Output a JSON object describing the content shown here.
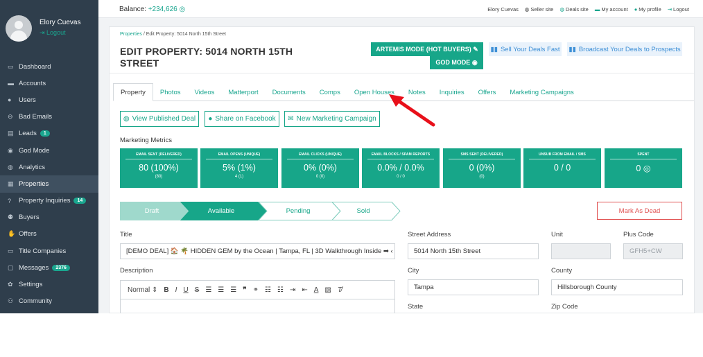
{
  "user": {
    "name": "Elory Cuevas",
    "logout": "Logout"
  },
  "sidebar": {
    "items": [
      {
        "label": "Dashboard",
        "icon": "▭"
      },
      {
        "label": "Accounts",
        "icon": "▬"
      },
      {
        "label": "Users",
        "icon": "●"
      },
      {
        "label": "Bad Emails",
        "icon": "⊖"
      },
      {
        "label": "Leads",
        "icon": "▤",
        "badge": "1"
      },
      {
        "label": "God Mode",
        "icon": "◉"
      },
      {
        "label": "Analytics",
        "icon": "◍"
      },
      {
        "label": "Properties",
        "icon": "▦"
      },
      {
        "label": "Property Inquiries",
        "icon": "?",
        "badge": "14"
      },
      {
        "label": "Buyers",
        "icon": "⚉"
      },
      {
        "label": "Offers",
        "icon": "✋"
      },
      {
        "label": "Title Companies",
        "icon": "▭"
      },
      {
        "label": "Messages",
        "icon": "▢",
        "badge": "2376"
      },
      {
        "label": "Settings",
        "icon": "✿"
      },
      {
        "label": "Community",
        "icon": "⚇"
      }
    ]
  },
  "topbar": {
    "balance_label": "Balance:",
    "balance_value": "+234,626",
    "links": {
      "name": "Elory Cuevas",
      "seller": "Seller site",
      "deals": "Deals site",
      "account": "My account",
      "profile": "My profile",
      "logout": "Logout"
    }
  },
  "breadcrumb": {
    "root": "Properties",
    "current": " / Edit Property: 5014 North 15th Street"
  },
  "page_title": "EDIT PROPERTY: 5014 NORTH 15TH STREET",
  "header_buttons": {
    "artemis": "ARTEMIS MODE (HOT BUYERS) ✎",
    "god": "GOD MODE ◉",
    "sell": "Sell Your Deals Fast",
    "broadcast": "Broadcast Your Deals to Prospects"
  },
  "tabs": [
    "Property",
    "Photos",
    "Videos",
    "Matterport",
    "Documents",
    "Comps",
    "Open Houses",
    "Notes",
    "Inquiries",
    "Offers",
    "Marketing Campaigns"
  ],
  "actions": {
    "view": "View Published Deal",
    "facebook": "Share on Facebook",
    "campaign": "New Marketing Campaign"
  },
  "metrics": {
    "title": "Marketing Metrics",
    "items": [
      {
        "label": "EMAIL SENT (DELIVERED)",
        "value": "80 (100%)",
        "sub": "(80)"
      },
      {
        "label": "EMAIL OPENS (UNIQUE)",
        "value": "5% (1%)",
        "sub": "4 (1)"
      },
      {
        "label": "EMAIL CLICKS (UNIQUE)",
        "value": "0% (0%)",
        "sub": "0 (0)"
      },
      {
        "label": "EMAIL BLOCKS / SPAM REPORTS",
        "value": "0.0% / 0.0%",
        "sub": "0 / 0"
      },
      {
        "label": "SMS SENT (DELIVERED)",
        "value": "0 (0%)",
        "sub": "(0)"
      },
      {
        "label": "UNSUB FROM EMAIL / SMS",
        "value": "0 / 0",
        "sub": ""
      },
      {
        "label": "SPENT",
        "value": "0 ◎",
        "sub": ""
      }
    ]
  },
  "pipeline": {
    "stages": [
      "Draft",
      "Available",
      "Pending",
      "Sold"
    ],
    "dead": "Mark As Dead"
  },
  "form": {
    "title_label": "Title",
    "title_value": "[DEMO DEAL] 🏠 🌴 HIDDEN GEM by the Ocean | Tampa, FL | 3D Walkthrough Inside ➡ ‹",
    "description_label": "Description",
    "editor_format": "Normal",
    "street_label": "Street Address",
    "street_value": "5014 North 15th Street",
    "unit_label": "Unit",
    "unit_value": "",
    "plus_label": "Plus Code",
    "plus_value": "GFH5+CW",
    "city_label": "City",
    "city_value": "Tampa",
    "county_label": "County",
    "county_value": "Hillsborough County",
    "state_label": "State",
    "zip_label": "Zip Code"
  },
  "colors": {
    "accent": "#17a689",
    "sidebar": "#2f3e4c",
    "danger": "#e05050",
    "link_blue": "#3d8fd6"
  }
}
